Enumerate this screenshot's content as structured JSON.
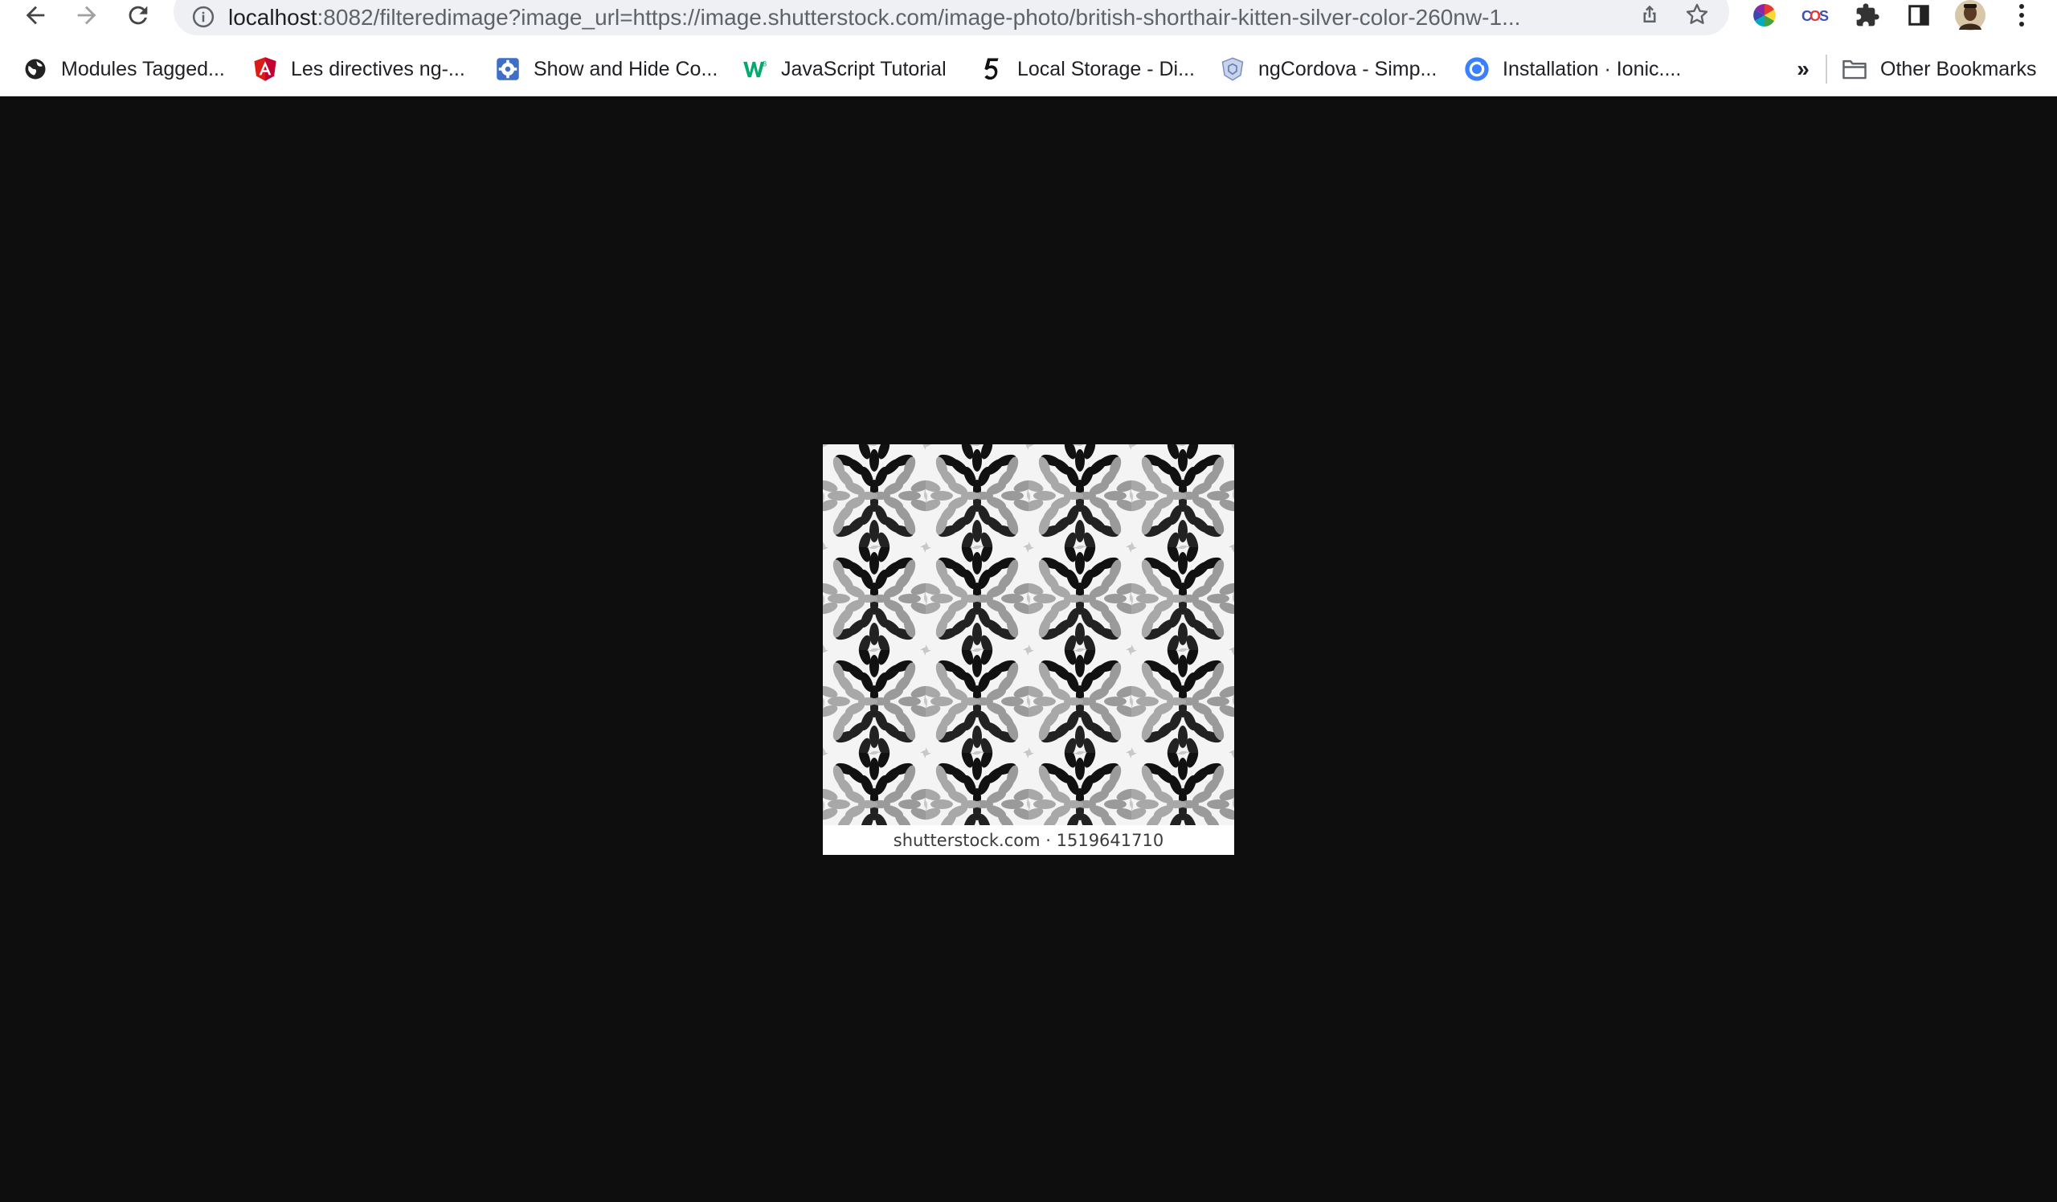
{
  "browser": {
    "url_host": "localhost",
    "url_rest": ":8082/filteredimage?image_url=https://image.shutterstock.com/image-photo/british-shorthair-kitten-silver-color-260nw-1...",
    "back_icon": "arrow-left-icon",
    "forward_icon": "arrow-right-icon",
    "reload_icon": "reload-icon",
    "extensions": [
      "color-wheel-icon",
      "cors-icon",
      "puzzle-icon",
      "side-panel-icon",
      "avatar",
      "kebab-menu-icon"
    ]
  },
  "bookmarks": {
    "items": [
      {
        "label": "Modules Tagged...",
        "icon": "globe-icon"
      },
      {
        "label": "Les directives ng-...",
        "icon": "angular-icon"
      },
      {
        "label": "Show and Hide Co...",
        "icon": "gear-icon"
      },
      {
        "label": "JavaScript Tutorial",
        "icon": "w3schools-icon"
      },
      {
        "label": "Local Storage - Di...",
        "icon": "five-icon"
      },
      {
        "label": "ngCordova - Simp...",
        "icon": "shield-icon"
      },
      {
        "label": "Installation · Ionic....",
        "icon": "ionic-icon"
      }
    ],
    "more_label": "»",
    "other_label": "Other Bookmarks"
  },
  "image": {
    "watermark": "shutterstock.com · 1519641710"
  },
  "colors": {
    "page_background": "#0e0e0e",
    "toolbar_background": "#ffffff",
    "omnibox_background": "#eef0f3"
  }
}
